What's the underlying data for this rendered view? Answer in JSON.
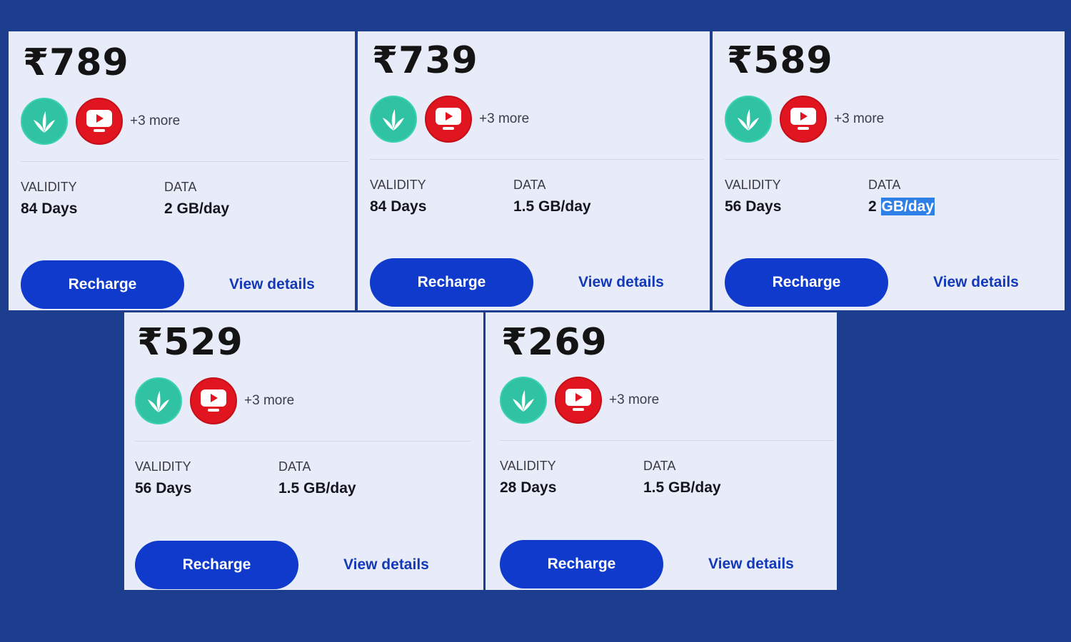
{
  "colors": {
    "background": "#1d3d8f",
    "card": "#e8ecf8",
    "button": "#0f3acb",
    "link": "#1439b8",
    "icon_green": "#2fc3a3",
    "icon_red": "#e0151f",
    "selection": "#2e7fe6"
  },
  "labels": {
    "validity": "VALIDITY",
    "data": "DATA",
    "recharge": "Recharge",
    "view_details": "View details",
    "more": "+3 more"
  },
  "plans": [
    {
      "price": "₹789",
      "validity": "84 Days",
      "data": "2 GB/day"
    },
    {
      "price": "₹739",
      "validity": "84 Days",
      "data": "1.5 GB/day"
    },
    {
      "price": "₹589",
      "validity": "56 Days",
      "data_prefix": "2 ",
      "data_selected": "GB/day"
    },
    {
      "price": "₹529",
      "validity": "56 Days",
      "data": "1.5 GB/day"
    },
    {
      "price": "₹269",
      "validity": "28 Days",
      "data": "1.5 GB/day"
    }
  ],
  "icons": [
    "jiosaavn-icon",
    "jiotv-icon"
  ]
}
